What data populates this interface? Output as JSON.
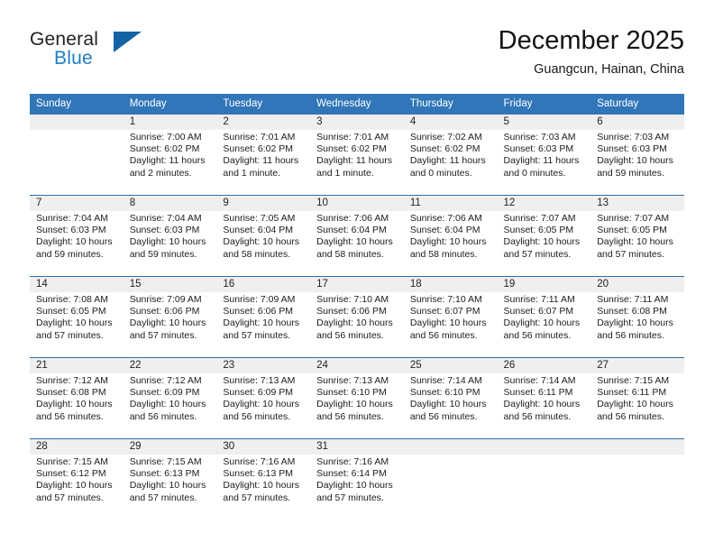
{
  "brand": {
    "name_part1": "General",
    "name_part2": "Blue",
    "triangle_color": "#1464a5",
    "blue_color": "#1f7dc4"
  },
  "header": {
    "month_title": "December 2025",
    "location": "Guangcun, Hainan, China"
  },
  "theme": {
    "header_bg": "#3176b8",
    "daynum_bg": "#efefef",
    "row_divider": "#2f6fae"
  },
  "calendar": {
    "weekday_headers": [
      "Sunday",
      "Monday",
      "Tuesday",
      "Wednesday",
      "Thursday",
      "Friday",
      "Saturday"
    ],
    "weeks": [
      [
        {
          "day": "",
          "lines": []
        },
        {
          "day": "1",
          "lines": [
            "Sunrise: 7:00 AM",
            "Sunset: 6:02 PM",
            "Daylight: 11 hours",
            "and 2 minutes."
          ]
        },
        {
          "day": "2",
          "lines": [
            "Sunrise: 7:01 AM",
            "Sunset: 6:02 PM",
            "Daylight: 11 hours",
            "and 1 minute."
          ]
        },
        {
          "day": "3",
          "lines": [
            "Sunrise: 7:01 AM",
            "Sunset: 6:02 PM",
            "Daylight: 11 hours",
            "and 1 minute."
          ]
        },
        {
          "day": "4",
          "lines": [
            "Sunrise: 7:02 AM",
            "Sunset: 6:02 PM",
            "Daylight: 11 hours",
            "and 0 minutes."
          ]
        },
        {
          "day": "5",
          "lines": [
            "Sunrise: 7:03 AM",
            "Sunset: 6:03 PM",
            "Daylight: 11 hours",
            "and 0 minutes."
          ]
        },
        {
          "day": "6",
          "lines": [
            "Sunrise: 7:03 AM",
            "Sunset: 6:03 PM",
            "Daylight: 10 hours",
            "and 59 minutes."
          ]
        }
      ],
      [
        {
          "day": "7",
          "lines": [
            "Sunrise: 7:04 AM",
            "Sunset: 6:03 PM",
            "Daylight: 10 hours",
            "and 59 minutes."
          ]
        },
        {
          "day": "8",
          "lines": [
            "Sunrise: 7:04 AM",
            "Sunset: 6:03 PM",
            "Daylight: 10 hours",
            "and 59 minutes."
          ]
        },
        {
          "day": "9",
          "lines": [
            "Sunrise: 7:05 AM",
            "Sunset: 6:04 PM",
            "Daylight: 10 hours",
            "and 58 minutes."
          ]
        },
        {
          "day": "10",
          "lines": [
            "Sunrise: 7:06 AM",
            "Sunset: 6:04 PM",
            "Daylight: 10 hours",
            "and 58 minutes."
          ]
        },
        {
          "day": "11",
          "lines": [
            "Sunrise: 7:06 AM",
            "Sunset: 6:04 PM",
            "Daylight: 10 hours",
            "and 58 minutes."
          ]
        },
        {
          "day": "12",
          "lines": [
            "Sunrise: 7:07 AM",
            "Sunset: 6:05 PM",
            "Daylight: 10 hours",
            "and 57 minutes."
          ]
        },
        {
          "day": "13",
          "lines": [
            "Sunrise: 7:07 AM",
            "Sunset: 6:05 PM",
            "Daylight: 10 hours",
            "and 57 minutes."
          ]
        }
      ],
      [
        {
          "day": "14",
          "lines": [
            "Sunrise: 7:08 AM",
            "Sunset: 6:05 PM",
            "Daylight: 10 hours",
            "and 57 minutes."
          ]
        },
        {
          "day": "15",
          "lines": [
            "Sunrise: 7:09 AM",
            "Sunset: 6:06 PM",
            "Daylight: 10 hours",
            "and 57 minutes."
          ]
        },
        {
          "day": "16",
          "lines": [
            "Sunrise: 7:09 AM",
            "Sunset: 6:06 PM",
            "Daylight: 10 hours",
            "and 57 minutes."
          ]
        },
        {
          "day": "17",
          "lines": [
            "Sunrise: 7:10 AM",
            "Sunset: 6:06 PM",
            "Daylight: 10 hours",
            "and 56 minutes."
          ]
        },
        {
          "day": "18",
          "lines": [
            "Sunrise: 7:10 AM",
            "Sunset: 6:07 PM",
            "Daylight: 10 hours",
            "and 56 minutes."
          ]
        },
        {
          "day": "19",
          "lines": [
            "Sunrise: 7:11 AM",
            "Sunset: 6:07 PM",
            "Daylight: 10 hours",
            "and 56 minutes."
          ]
        },
        {
          "day": "20",
          "lines": [
            "Sunrise: 7:11 AM",
            "Sunset: 6:08 PM",
            "Daylight: 10 hours",
            "and 56 minutes."
          ]
        }
      ],
      [
        {
          "day": "21",
          "lines": [
            "Sunrise: 7:12 AM",
            "Sunset: 6:08 PM",
            "Daylight: 10 hours",
            "and 56 minutes."
          ]
        },
        {
          "day": "22",
          "lines": [
            "Sunrise: 7:12 AM",
            "Sunset: 6:09 PM",
            "Daylight: 10 hours",
            "and 56 minutes."
          ]
        },
        {
          "day": "23",
          "lines": [
            "Sunrise: 7:13 AM",
            "Sunset: 6:09 PM",
            "Daylight: 10 hours",
            "and 56 minutes."
          ]
        },
        {
          "day": "24",
          "lines": [
            "Sunrise: 7:13 AM",
            "Sunset: 6:10 PM",
            "Daylight: 10 hours",
            "and 56 minutes."
          ]
        },
        {
          "day": "25",
          "lines": [
            "Sunrise: 7:14 AM",
            "Sunset: 6:10 PM",
            "Daylight: 10 hours",
            "and 56 minutes."
          ]
        },
        {
          "day": "26",
          "lines": [
            "Sunrise: 7:14 AM",
            "Sunset: 6:11 PM",
            "Daylight: 10 hours",
            "and 56 minutes."
          ]
        },
        {
          "day": "27",
          "lines": [
            "Sunrise: 7:15 AM",
            "Sunset: 6:11 PM",
            "Daylight: 10 hours",
            "and 56 minutes."
          ]
        }
      ],
      [
        {
          "day": "28",
          "lines": [
            "Sunrise: 7:15 AM",
            "Sunset: 6:12 PM",
            "Daylight: 10 hours",
            "and 57 minutes."
          ]
        },
        {
          "day": "29",
          "lines": [
            "Sunrise: 7:15 AM",
            "Sunset: 6:13 PM",
            "Daylight: 10 hours",
            "and 57 minutes."
          ]
        },
        {
          "day": "30",
          "lines": [
            "Sunrise: 7:16 AM",
            "Sunset: 6:13 PM",
            "Daylight: 10 hours",
            "and 57 minutes."
          ]
        },
        {
          "day": "31",
          "lines": [
            "Sunrise: 7:16 AM",
            "Sunset: 6:14 PM",
            "Daylight: 10 hours",
            "and 57 minutes."
          ]
        },
        {
          "day": "",
          "lines": []
        },
        {
          "day": "",
          "lines": []
        },
        {
          "day": "",
          "lines": []
        }
      ]
    ]
  }
}
